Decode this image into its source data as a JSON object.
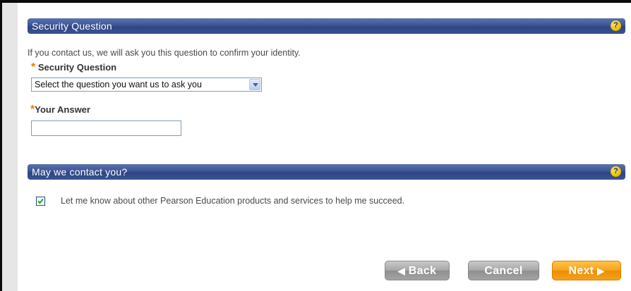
{
  "security_section": {
    "title": "Security Question",
    "help": "?",
    "intro": "If you contact us, we will ask you this question to confirm your identity.",
    "question_label": "Security Question",
    "question_select_value": "Select the question you want us to ask you",
    "answer_label": "Your Answer",
    "answer_value": "",
    "required_mark": "*"
  },
  "contact_section": {
    "title": "May we contact you?",
    "help": "?",
    "consent_checked": true,
    "consent_label": "Let me know about other Pearson Education products and services to help me succeed."
  },
  "buttons": {
    "back": "Back",
    "cancel": "Cancel",
    "next": "Next"
  },
  "icons": {
    "help": "help-icon",
    "back": "triangle-left-icon",
    "next": "triangle-right-icon",
    "dropdown": "chevron-down-icon",
    "checkmark": "checkmark-icon"
  },
  "colors": {
    "header_bar": "#3c5496",
    "required_star": "#ef7d00",
    "next_button": "#f7a21b",
    "neutral_button": "#a6a6a6",
    "help_badge": "#f2c200"
  }
}
